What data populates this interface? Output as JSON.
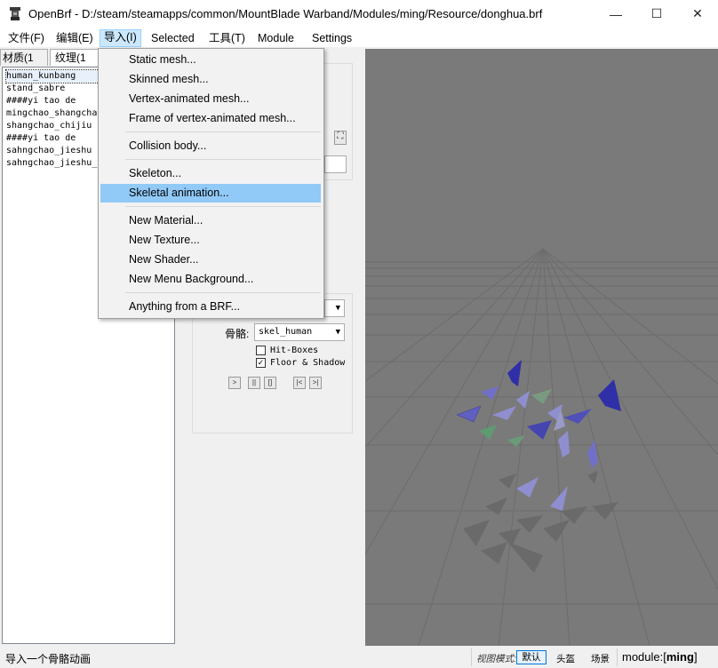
{
  "window": {
    "app_name": "OpenBrf",
    "path": " - D:/steam/steamapps/common/MountBlade Warband/Modules/ming/Resource/donghua.brf",
    "minimize": "—",
    "maximize": "☐",
    "close": "✕"
  },
  "menubar": {
    "items": [
      "文件(F)",
      "编辑(E)",
      "导入(I)",
      "Selected",
      "工具(T)",
      "Module",
      "Settings"
    ]
  },
  "left_panel": {
    "tabs": [
      "材质(1",
      "纹理(1"
    ],
    "items": [
      "human_kunbang",
      "stand_sabre",
      "####yi tao de",
      "mingchao_shangchao",
      "shangchao_chijiu",
      "####yi tao de",
      "sahngchao_jieshu",
      "sahngchao_jieshu_"
    ]
  },
  "mid_panel": {
    "skeleton_label": "骨骼:",
    "skeleton_value": "skel_human",
    "hitboxes_label": "Hit-Boxes",
    "hitboxes_checked": false,
    "floor_label": "Floor & Shadow",
    "floor_checked": true,
    "mark": "✓",
    "play": ">",
    "pause": "||",
    "stop": "[]",
    "prev": "|<",
    "next": ">|",
    "expand": "⛶"
  },
  "import_menu": {
    "items": [
      "Static mesh...",
      "Skinned mesh...",
      "Vertex-animated mesh...",
      "Frame of vertex-animated mesh...",
      "Collision body...",
      "Skeleton...",
      "Skeletal animation...",
      "New Material...",
      "New Texture...",
      "New Shader...",
      "New Menu Background...",
      "Anything from a BRF..."
    ],
    "highlighted": "Skeletal animation..."
  },
  "statusbar": {
    "message": "导入一个骨骼动画",
    "view_mode_label": "视图模式:",
    "modes": [
      "默认",
      "头盔",
      "场景"
    ],
    "module_label": "module:[",
    "module_name": "ming",
    "module_close": "]"
  },
  "colors": {
    "viewport": "#7a7a7a",
    "grid": "#6a6a6a",
    "highlight": "#91c9f7",
    "bone_blue": "#3a3ab0",
    "bone_lavender": "#8f8fd0",
    "bone_green": "#5f9a70"
  }
}
